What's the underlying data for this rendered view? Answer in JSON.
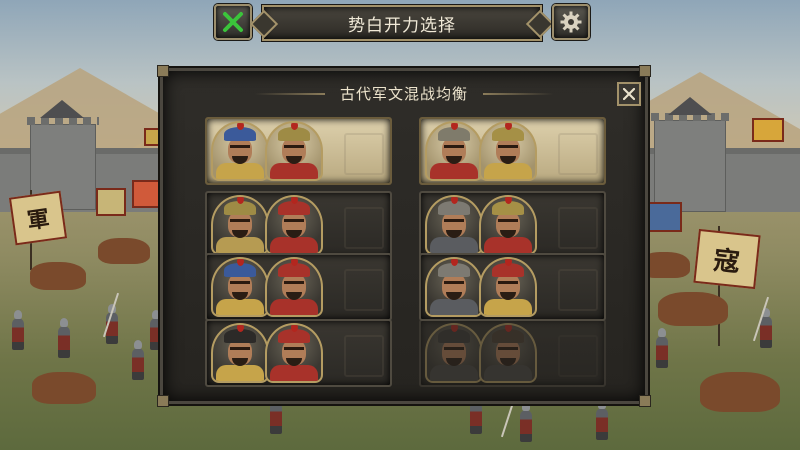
{
  "window": {
    "title": "势白开力选择",
    "close_icon": "green-x-close-icon",
    "settings_icon": "gear-icon"
  },
  "panel": {
    "title": "古代军文混战均衡",
    "close_icon": "close-x-icon"
  },
  "scene": {
    "flag_char_left": "軍",
    "flag_char_right": "寇"
  },
  "faction_cards": [
    {
      "selected": true,
      "locked": false,
      "generals": [
        {
          "helmet": "#3b5a9a",
          "armor": "#c6a44a"
        },
        {
          "helmet": "#9e8b45",
          "armor": "#a8322a"
        }
      ]
    },
    {
      "selected": true,
      "locked": false,
      "generals": [
        {
          "helmet": "#7f7b6b",
          "armor": "#a8322a"
        },
        {
          "helmet": "#a59046",
          "armor": "#c6a44a"
        }
      ]
    },
    {
      "selected": false,
      "locked": false,
      "generals": [
        {
          "helmet": "#9e8b45",
          "armor": "#b69b52"
        },
        {
          "helmet": "#a8322a",
          "armor": "#a8322a"
        }
      ]
    },
    {
      "selected": false,
      "locked": false,
      "generals": [
        {
          "helmet": "#7d7a72",
          "armor": "#5a5c60"
        },
        {
          "helmet": "#a59046",
          "armor": "#a8322a"
        }
      ]
    },
    {
      "selected": false,
      "locked": false,
      "generals": [
        {
          "helmet": "#3b5a9a",
          "armor": "#c6a44a"
        },
        {
          "helmet": "#a8322a",
          "armor": "#a8322a"
        }
      ]
    },
    {
      "selected": false,
      "locked": false,
      "generals": [
        {
          "helmet": "#7d7a72",
          "armor": "#5a5c60"
        },
        {
          "helmet": "#a8322a",
          "armor": "#c6a44a"
        }
      ]
    },
    {
      "selected": false,
      "locked": false,
      "generals": [
        {
          "helmet": "#2c2a28",
          "armor": "#c6a44a"
        },
        {
          "helmet": "#a8322a",
          "armor": "#a8322a"
        }
      ]
    },
    {
      "selected": false,
      "locked": true,
      "generals": [
        {
          "helmet": "#3a3835",
          "armor": "#4a4843"
        },
        {
          "helmet": "#4a3e30",
          "armor": "#4a4843"
        }
      ]
    }
  ],
  "colors": {
    "accent_gold": "#a3926a",
    "close_green": "#3bc43b",
    "selected_card": "#ddd0ac"
  }
}
